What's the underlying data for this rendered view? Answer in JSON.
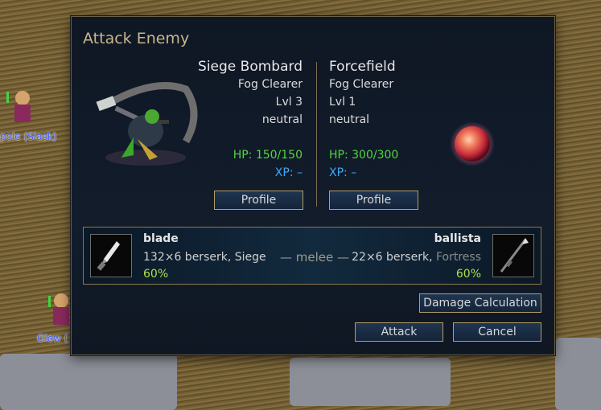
{
  "map": {
    "unit_labels": [
      "pole (Slask)",
      "Glew (",
      ""
    ]
  },
  "dialog": {
    "title": "Attack Enemy",
    "attacker": {
      "name": "Siege Bombard",
      "side": "Fog Clearer",
      "level": "Lvl 3",
      "alignment": "neutral",
      "hp": "HP: 150/150",
      "xp": "XP: –",
      "profile_label": "Profile"
    },
    "defender": {
      "name": "Forcefield",
      "side": "Fog Clearer",
      "level": "Lvl 1",
      "alignment": "neutral",
      "hp": "HP: 300/300",
      "xp": "XP: –",
      "profile_label": "Profile"
    },
    "attack": {
      "attacker_weapon": {
        "name": "blade",
        "stats": "132×6 berserk, ",
        "special": "Siege",
        "chance": "60%",
        "icon": "dagger-icon"
      },
      "range": "— melee —",
      "defender_weapon": {
        "name": "ballista",
        "stats": "22×6 berserk, ",
        "special": "Fortress",
        "chance": "60%",
        "icon": "spear-icon"
      }
    },
    "buttons": {
      "damage_calc": "Damage Calculation",
      "attack": "Attack",
      "cancel": "Cancel"
    }
  },
  "colors": {
    "title": "#c8b88c",
    "hp": "#53d63f",
    "xp": "#3fa9f5",
    "chance": "#a9e04a",
    "border": "#b3a067"
  }
}
